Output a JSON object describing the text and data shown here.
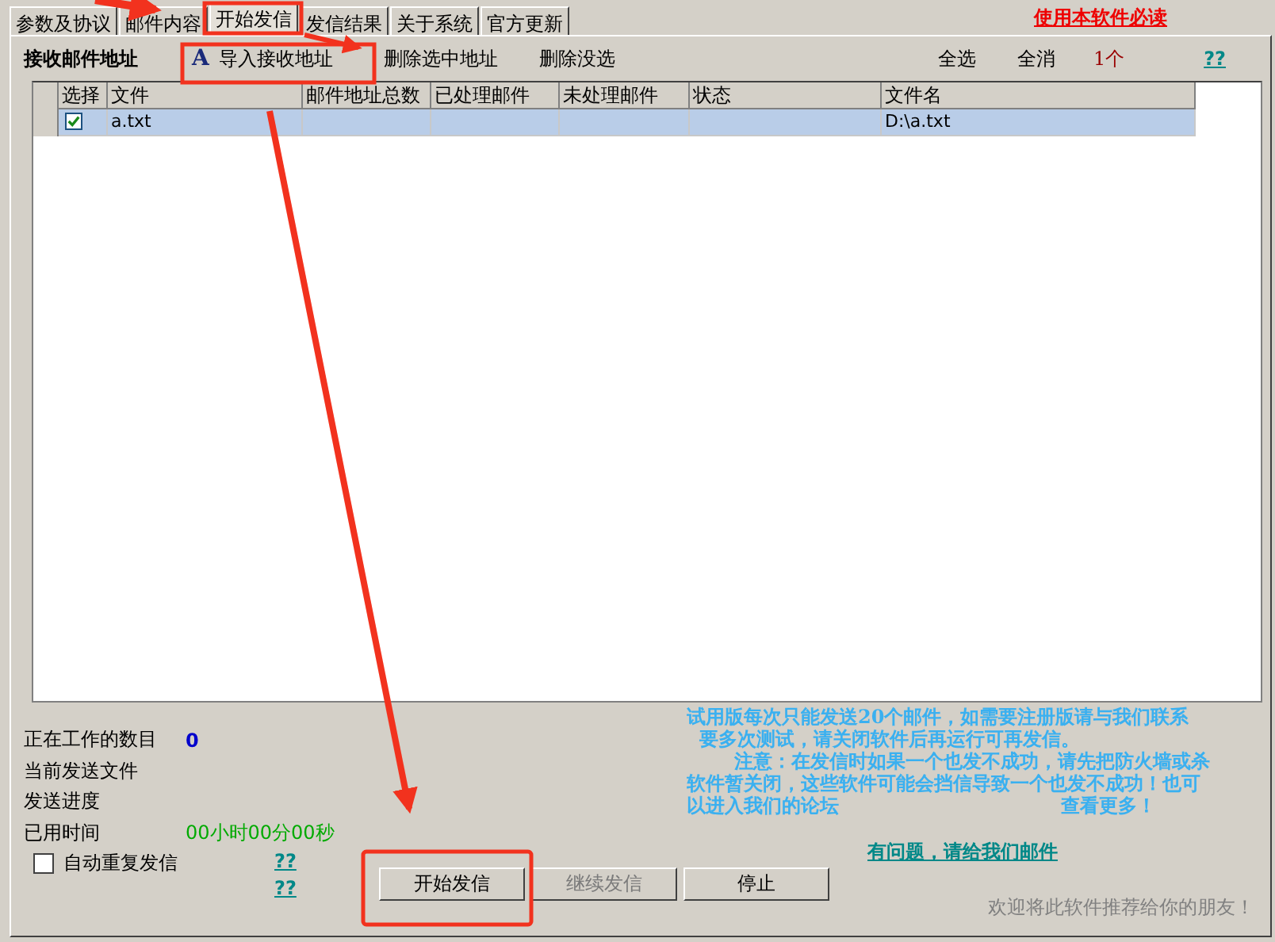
{
  "tabs": [
    {
      "label": "参数及协议",
      "selected": false
    },
    {
      "label": "邮件内容",
      "selected": false
    },
    {
      "label": "开始发信",
      "selected": true
    },
    {
      "label": "发信结果",
      "selected": false
    },
    {
      "label": "关于系统",
      "selected": false
    },
    {
      "label": "官方更新",
      "selected": false
    }
  ],
  "must_read_link": "使用本软件必读",
  "toolbar": {
    "title": "接收邮件地址",
    "import_button": "导入接收地址",
    "import_icon_glyph": "A",
    "actions": [
      "删除选中地址",
      "删除没选"
    ],
    "select_all": "全选",
    "select_none": "全消",
    "count": "1个",
    "help": "??"
  },
  "table": {
    "columns": [
      "选择",
      "文件",
      "邮件地址总数",
      "已处理邮件",
      "未处理邮件",
      "状态",
      "文件名"
    ],
    "rows": [
      {
        "checked": true,
        "selected": true,
        "cells": [
          "",
          "a.txt",
          "",
          "",
          "",
          "",
          "D:\\a.txt"
        ]
      }
    ]
  },
  "status": [
    {
      "label": "正在工作的数目",
      "value": "0",
      "kind": "count"
    },
    {
      "label": "当前发送文件",
      "kind": "plain"
    },
    {
      "label": "发送进度",
      "kind": "plain"
    },
    {
      "label": "已用时间",
      "value": "00小时00分00秒",
      "kind": "time"
    }
  ],
  "auto_repeat": {
    "label": "自动重复发信",
    "checked": false
  },
  "help_links": [
    "??",
    "??"
  ],
  "buttons": [
    {
      "label": "开始发信",
      "disabled": false
    },
    {
      "label": "继续发信",
      "disabled": true
    },
    {
      "label": "停止",
      "disabled": false
    }
  ],
  "notice_lines": [
    "试用版每次只能发送20个邮件，如需要注册版请与我们联系",
    "要多次测试，请关闭软件后再运行可再发信。",
    "注意：在发信时如果一个也发不成功，请先把防火墙或杀",
    "软件暂关闭，这些软件可能会挡信导致一个也发不成功！也可",
    "以进入我们的论坛",
    "查看更多！"
  ],
  "contact_link": "有问题，请给我们邮件",
  "recommend": "欢迎将此软件推荐给你的朋友！"
}
